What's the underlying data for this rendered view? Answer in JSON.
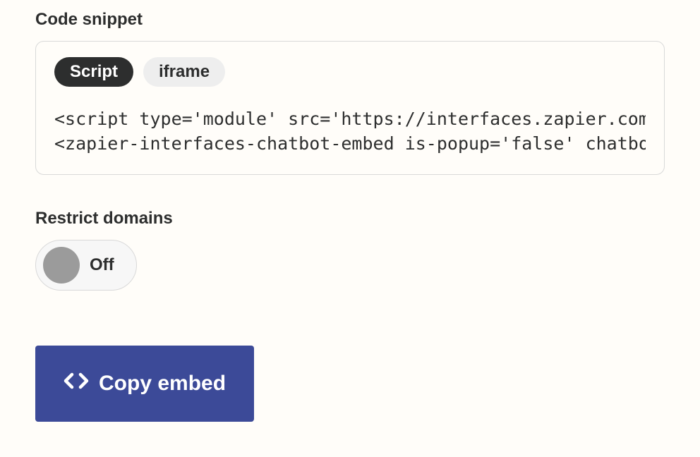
{
  "codeSnippet": {
    "label": "Code snippet",
    "tabs": {
      "script": "Script",
      "iframe": "iframe"
    },
    "lines": [
      "<script type='module' src='https://interfaces.zapier.com/",
      "<zapier-interfaces-chatbot-embed is-popup='false' chatbot"
    ]
  },
  "restrict": {
    "label": "Restrict domains",
    "state": "Off"
  },
  "actions": {
    "copy": "Copy embed"
  }
}
